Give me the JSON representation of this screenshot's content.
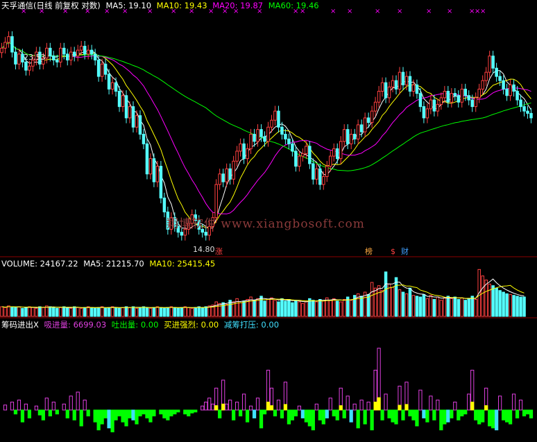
{
  "header": {
    "title": "天孚通信(日线 前复权 对数)",
    "ma5": "MA5: 19.10",
    "ma10": "MA10: 19.43",
    "ma20": "MA20: 19.87",
    "ma60": "MA60: 19.46"
  },
  "volume_header": {
    "title": "VOLUME: 24167.22",
    "ma5": "MA5: 21215.70",
    "ma10": "MA10: 25415.45"
  },
  "indicator_header": {
    "title": "筹码进出X",
    "absorb": "吸进量: 6699.03",
    "spit": "吐出量: 0.00",
    "strong": "买进强烈: 0.00",
    "reduce": "减筹打压: 0.00"
  },
  "annotations": {
    "high_label": "23.53",
    "low_label": "14.80",
    "tag_zhang": "涨",
    "tag_bang": "榜",
    "tag_s": "$",
    "tag_cai": "财"
  },
  "watermark": "翔博软件 www.xiangbosoft.com",
  "colors": {
    "up": "#ff4040",
    "down": "#54ffff",
    "ma5": "#ffffff",
    "ma10": "#ffff00",
    "ma20": "#ff00ff",
    "ma60": "#00ff00",
    "absorb": "#e040e0",
    "spit": "#00ff00",
    "strong": "#ffff00",
    "reduce": "#40e0ff"
  },
  "chart_data": [
    {
      "type": "candlestick",
      "scale": "log",
      "ylim": [
        14.5,
        24.5
      ],
      "closes": [
        22.6,
        22.9,
        23.2,
        22.4,
        21.8,
        22.3,
        21.9,
        21.5,
        21.7,
        22.0,
        22.4,
        21.8,
        22.1,
        22.6,
        22.2,
        22.0,
        21.9,
        22.6,
        22.3,
        22.0,
        22.4,
        22.2,
        22.5,
        22.7,
        22.3,
        22.5,
        22.3,
        22.0,
        21.2,
        21.8,
        21.3,
        20.6,
        20.9,
        20.5,
        19.8,
        20.3,
        19.3,
        19.8,
        18.9,
        19.4,
        18.6,
        18.2,
        17.0,
        17.6,
        16.7,
        17.3,
        16.1,
        15.6,
        15.0,
        15.4,
        15.1,
        14.9,
        14.8,
        15.0,
        15.2,
        15.5,
        15.3,
        15.0,
        14.9,
        14.8,
        15.1,
        15.4,
        16.6,
        17.0,
        16.7,
        17.2,
        16.8,
        17.5,
        17.9,
        18.2,
        17.6,
        18.0,
        18.6,
        18.3,
        18.8,
        18.5,
        18.3,
        18.9,
        19.2,
        19.6,
        18.9,
        18.6,
        18.4,
        18.2,
        17.9,
        17.3,
        17.7,
        17.8,
        18.1,
        17.4,
        16.8,
        17.2,
        16.6,
        16.9,
        17.3,
        17.7,
        18.0,
        17.6,
        18.3,
        18.8,
        18.2,
        18.6,
        18.4,
        19.0,
        18.7,
        19.3,
        19.1,
        19.6,
        20.0,
        20.5,
        20.9,
        20.2,
        20.7,
        21.0,
        20.6,
        21.4,
        20.8,
        21.2,
        20.5,
        20.8,
        20.4,
        19.8,
        19.3,
        19.7,
        20.1,
        19.6,
        19.9,
        20.2,
        20.5,
        20.0,
        20.4,
        20.3,
        20.0,
        20.6,
        20.3,
        20.1,
        19.8,
        20.2,
        20.6,
        21.0,
        21.4,
        22.2,
        21.6,
        21.2,
        21.0,
        20.6,
        20.3,
        20.8,
        20.5,
        20.1,
        19.8,
        19.6,
        19.5,
        19.3
      ],
      "marks": {
        "high": 23.53,
        "low": 14.8,
        "tags": [
          "涨",
          "榜",
          "$",
          "财"
        ]
      }
    },
    {
      "type": "bar",
      "name": "VOLUME",
      "values": [
        12,
        11,
        13,
        12,
        11,
        12,
        10,
        11,
        12,
        11,
        10,
        12,
        11,
        13,
        12,
        11,
        10,
        11,
        12,
        11,
        10,
        12,
        11,
        10,
        11,
        12,
        11,
        10,
        11,
        12,
        10,
        11,
        12,
        11,
        10,
        11,
        12,
        11,
        12,
        10,
        11,
        12,
        11,
        10,
        11,
        12,
        11,
        10,
        11,
        12,
        11,
        10,
        11,
        12,
        11,
        10,
        11,
        12,
        11,
        12,
        13,
        14,
        18,
        16,
        17,
        15,
        20,
        18,
        22,
        17,
        19,
        21,
        24,
        20,
        22,
        25,
        19,
        21,
        23,
        20,
        18,
        22,
        19,
        21,
        17,
        20,
        18,
        16,
        19,
        22,
        20,
        18,
        21,
        19,
        23,
        20,
        22,
        19,
        18,
        21,
        24,
        20,
        26,
        28,
        25,
        30,
        27,
        42,
        35,
        38,
        32,
        55,
        40,
        36,
        48,
        33,
        30,
        28,
        35,
        26,
        25,
        24,
        27,
        22,
        26,
        21,
        24,
        20,
        23,
        25,
        22,
        24,
        21,
        23,
        20,
        22,
        25,
        21,
        58,
        50,
        45,
        40,
        38,
        35,
        32,
        30,
        28,
        27,
        26,
        25,
        24,
        24
      ],
      "ylim": [
        0,
        60
      ]
    },
    {
      "type": "bar",
      "name": "筹码进出X",
      "values": [
        0,
        5,
        0,
        8,
        -4,
        10,
        -12,
        6,
        -8,
        0,
        4,
        -5,
        -10,
        12,
        -6,
        8,
        -4,
        0,
        6,
        -8,
        14,
        -10,
        18,
        -16,
        10,
        -6,
        0,
        -12,
        -20,
        -14,
        -8,
        -18,
        -22,
        -10,
        -6,
        -12,
        -16,
        -8,
        -10,
        -14,
        -6,
        -4,
        -8,
        -12,
        -6,
        0,
        -4,
        -8,
        -10,
        -6,
        -4,
        -2,
        0,
        -4,
        -6,
        -3,
        -2,
        0,
        4,
        8,
        12,
        6,
        22,
        -8,
        30,
        6,
        10,
        -10,
        8,
        -6,
        16,
        -12,
        4,
        -8,
        12,
        -18,
        -4,
        40,
        22,
        -6,
        10,
        -8,
        28,
        -14,
        -10,
        -6,
        4,
        -8,
        -12,
        -16,
        -20,
        6,
        -10,
        -14,
        -8,
        12,
        -6,
        -10,
        22,
        -8,
        14,
        -12,
        6,
        -18,
        10,
        -14,
        8,
        -20,
        40,
        62,
        -10,
        16,
        -8,
        -12,
        -14,
        24,
        -10,
        28,
        -6,
        -10,
        -16,
        20,
        -8,
        -12,
        14,
        -10,
        10,
        -20,
        -14,
        -12,
        -8,
        8,
        -10,
        -6,
        -4,
        16,
        40,
        -10,
        -14,
        -12,
        22,
        -16,
        -18,
        -20,
        14,
        -10,
        -12,
        -14,
        16,
        -8,
        10,
        -6,
        -4,
        -8
      ],
      "ylim": [
        -30,
        80
      ]
    }
  ]
}
